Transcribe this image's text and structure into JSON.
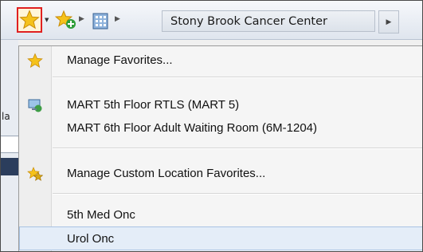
{
  "toolbar": {
    "favorites_icon": "star-icon",
    "add_favorite_icon": "star-add-icon",
    "location_icon": "building-icon",
    "breadcrumb_label": "Stony Brook Cancer Center"
  },
  "left_peek": {
    "char": "la"
  },
  "menu": {
    "items": [
      {
        "label": "Manage Favorites...",
        "icon": "star-icon"
      },
      {
        "label": "MART 5th Floor RTLS (MART 5)",
        "icon": "monitor-icon"
      },
      {
        "label": "MART 6th Floor Adult Waiting Room (6M-1204)",
        "icon": ""
      },
      {
        "label": "Manage Custom Location Favorites...",
        "icon": "star-multi-icon"
      },
      {
        "label": "5th  Med Onc",
        "icon": ""
      },
      {
        "label": "Urol Onc",
        "icon": ""
      }
    ]
  },
  "colors": {
    "highlight_border": "#e02020",
    "star": "#f2b613"
  }
}
